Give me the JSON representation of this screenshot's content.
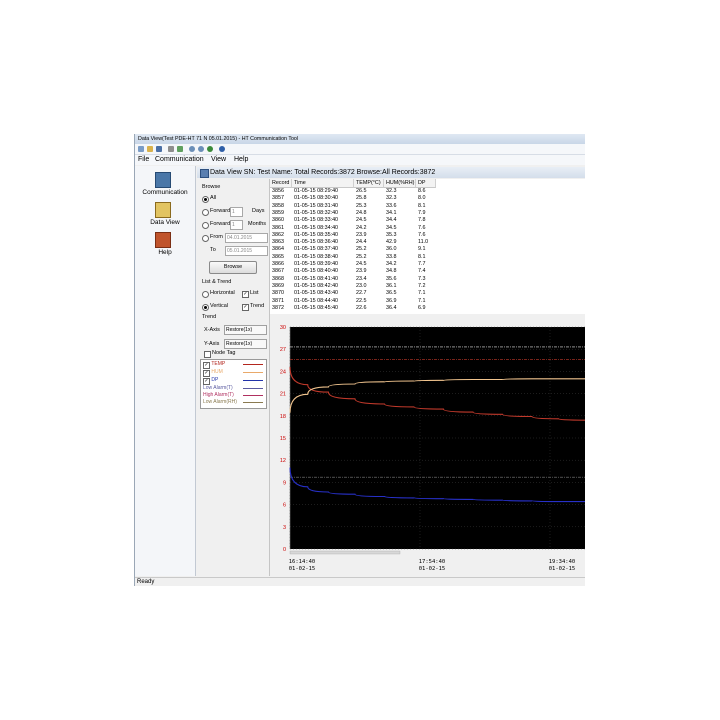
{
  "window": {
    "title": "Data View(Test PDE-HT 71 N 05.01.2015) - HT Communication Tool",
    "menu": [
      "File",
      "Communication",
      "View",
      "Help"
    ]
  },
  "nav": [
    {
      "label": "Communication",
      "icon": "communication-icon"
    },
    {
      "label": "Data View",
      "icon": "data-view-icon"
    },
    {
      "label": "Help",
      "icon": "help-book-icon"
    }
  ],
  "header": "Data View  SN:  Test Name:   Total Records:3872 Browse:All Records:3872",
  "browse": {
    "title": "Browse",
    "all": "All",
    "forward": "Forward",
    "days": "Days",
    "months": "Months",
    "forward_days_value": "1",
    "forward_months_value": "1",
    "from": "From",
    "from_date": "04.01.2015",
    "to": "To",
    "to_date": "05.01.2015",
    "browse_button": "Browse",
    "list_trend": "List & Trend",
    "horizontal": "Horizontal",
    "vertical": "Vertical",
    "list": "List",
    "trend_chk": "Trend",
    "trend": "Trend",
    "x_axis_label": "X-Axis",
    "y_axis_label": "Y-Axis",
    "x_axis_value": "Restore(1x)",
    "y_axis_value": "Restore(1x)",
    "node_tag": "Node Tag"
  },
  "legend": [
    {
      "label": "TEMP",
      "color": "#b3261e",
      "checked": true
    },
    {
      "label": "HUM",
      "color": "#e9a96a",
      "checked": true
    },
    {
      "label": "DP",
      "color": "#2233aa",
      "checked": true
    },
    {
      "label": "Low Alarm(T)",
      "color": "#5a5aa0",
      "checked": false
    },
    {
      "label": "High Alarm(T)",
      "color": "#b03060",
      "checked": false
    },
    {
      "label": "Low Alarm(RH)",
      "color": "#8a7a50",
      "checked": false
    }
  ],
  "table": {
    "columns": [
      "Record",
      "Time",
      "TEMP(°C)",
      "HUM(%RH)",
      "DP"
    ],
    "rows": [
      [
        "3856",
        "01-05-15 08:29:40",
        "26.5",
        "32.3",
        "8.6"
      ],
      [
        "3857",
        "01-05-15 08:30:40",
        "25.8",
        "32.3",
        "8.0"
      ],
      [
        "3858",
        "01-05-15 08:31:40",
        "25.3",
        "33.6",
        "8.1"
      ],
      [
        "3859",
        "01-05-15 08:32:40",
        "24.8",
        "34.1",
        "7.9"
      ],
      [
        "3860",
        "01-05-15 08:33:40",
        "24.5",
        "34.4",
        "7.8"
      ],
      [
        "3861",
        "01-05-15 08:34:40",
        "24.2",
        "34.5",
        "7.6"
      ],
      [
        "3862",
        "01-05-15 08:35:40",
        "23.9",
        "35.3",
        "7.6"
      ],
      [
        "3863",
        "01-05-15 08:36:40",
        "24.4",
        "42.9",
        "11.0"
      ],
      [
        "3864",
        "01-05-15 08:37:40",
        "25.2",
        "36.0",
        "9.1"
      ],
      [
        "3865",
        "01-05-15 08:38:40",
        "25.2",
        "33.8",
        "8.1"
      ],
      [
        "3866",
        "01-05-15 08:39:40",
        "24.5",
        "34.2",
        "7.7"
      ],
      [
        "3867",
        "01-05-15 08:40:40",
        "23.9",
        "34.8",
        "7.4"
      ],
      [
        "3868",
        "01-05-15 08:41:40",
        "23.4",
        "35.6",
        "7.3"
      ],
      [
        "3869",
        "01-05-15 08:42:40",
        "23.0",
        "36.1",
        "7.2"
      ],
      [
        "3870",
        "01-05-15 08:43:40",
        "22.7",
        "36.5",
        "7.1"
      ],
      [
        "3871",
        "01-05-15 08:44:40",
        "22.5",
        "36.9",
        "7.1"
      ],
      [
        "3872",
        "01-05-15 08:45:40",
        "22.6",
        "36.4",
        "6.9"
      ]
    ]
  },
  "chart_data": {
    "type": "line",
    "ylim": [
      0,
      30
    ],
    "y_ticks": [
      "30",
      "27",
      "24",
      "21",
      "18",
      "15",
      "12",
      "9",
      "6",
      "3",
      "0"
    ],
    "x_ticks": [
      {
        "time": "16:14:40",
        "date": "01-02-15"
      },
      {
        "time": "17:54:40",
        "date": "01-02-15"
      },
      {
        "time": "19:34:40",
        "date": "01-02-15"
      }
    ],
    "grid": true,
    "series": [
      {
        "name": "TEMP",
        "color": "#c0392b",
        "values": [
          24.6,
          22.2,
          21.2,
          20.3,
          19.6,
          19.2,
          18.9,
          18.5,
          18.2,
          17.9,
          17.6,
          17.4
        ]
      },
      {
        "name": "HUM",
        "color": "#f2c58f",
        "values": [
          18.4,
          20.9,
          21.9,
          22.3,
          22.6,
          22.7,
          22.8,
          22.9,
          22.9,
          23.0,
          23.0,
          23.0
        ]
      },
      {
        "name": "DP",
        "color": "#2730c8",
        "values": [
          11.0,
          8.4,
          7.7,
          7.4,
          7.1,
          6.9,
          6.8,
          6.7,
          6.6,
          6.5,
          6.4,
          6.4
        ]
      }
    ],
    "reference_lines": [
      {
        "y": 27.3,
        "color": "#e8e8e8"
      },
      {
        "y": 25.6,
        "color": "#c0392b"
      },
      {
        "y": 9.7,
        "color": "#808080"
      }
    ]
  }
}
